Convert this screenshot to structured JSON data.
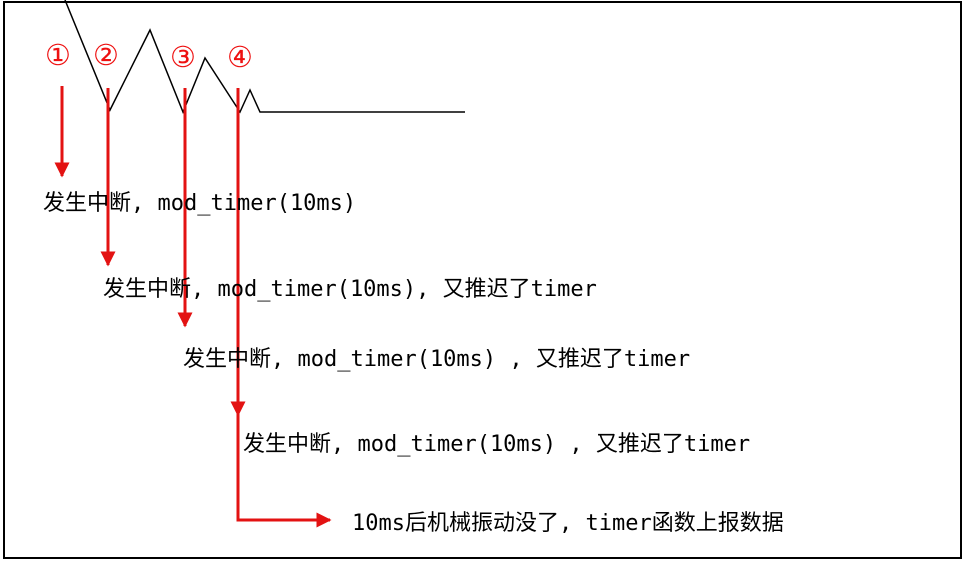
{
  "colors": {
    "arrow": "#e31212",
    "marker": "#ee1111",
    "text": "#000000",
    "waveform": "#000000"
  },
  "markers": [
    "①",
    "②",
    "③",
    "④"
  ],
  "lines": [
    "发生中断, mod_timer(10ms)",
    "发生中断, mod_timer(10ms), 又推迟了timer",
    "发生中断, mod_timer(10ms) , 又推迟了timer",
    "发生中断, mod_timer(10ms) , 又推迟了timer",
    "10ms后机械振动没了, timer函数上报数据"
  ]
}
